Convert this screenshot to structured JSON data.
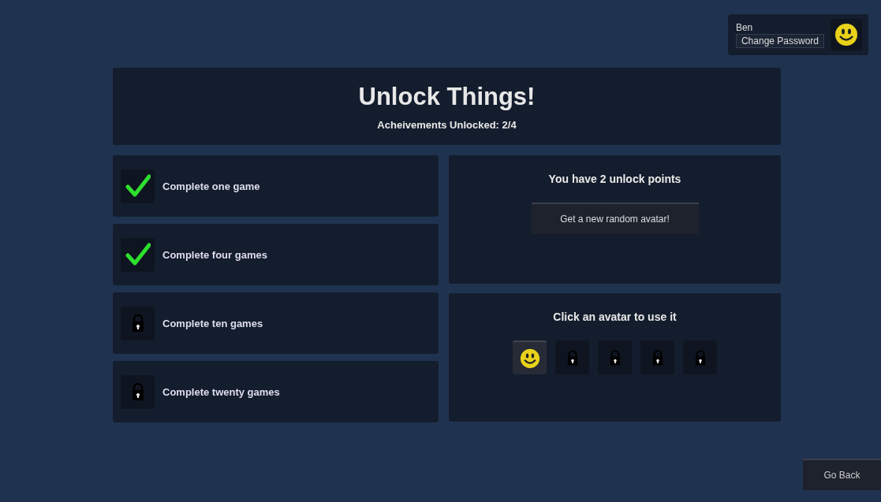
{
  "user": {
    "name": "Ben",
    "change_password": "Change Password",
    "avatar": {
      "kind": "smiley"
    }
  },
  "header": {
    "title": "Unlock Things!",
    "subtitle": "Acheivements Unlocked: 2/4"
  },
  "achievements": [
    {
      "label": "Complete one game",
      "unlocked": true
    },
    {
      "label": "Complete four games",
      "unlocked": true
    },
    {
      "label": "Complete ten games",
      "unlocked": false
    },
    {
      "label": "Complete twenty games",
      "unlocked": false
    }
  ],
  "unlock_panel": {
    "text": "You have 2 unlock points",
    "button": "Get a new random avatar!"
  },
  "avatar_panel": {
    "text": "Click an avatar to use it",
    "avatars": [
      {
        "kind": "smiley",
        "selected": true
      },
      {
        "kind": "lock",
        "selected": false
      },
      {
        "kind": "lock",
        "selected": false
      },
      {
        "kind": "lock",
        "selected": false
      },
      {
        "kind": "lock",
        "selected": false
      }
    ]
  },
  "go_back": "Go Back"
}
